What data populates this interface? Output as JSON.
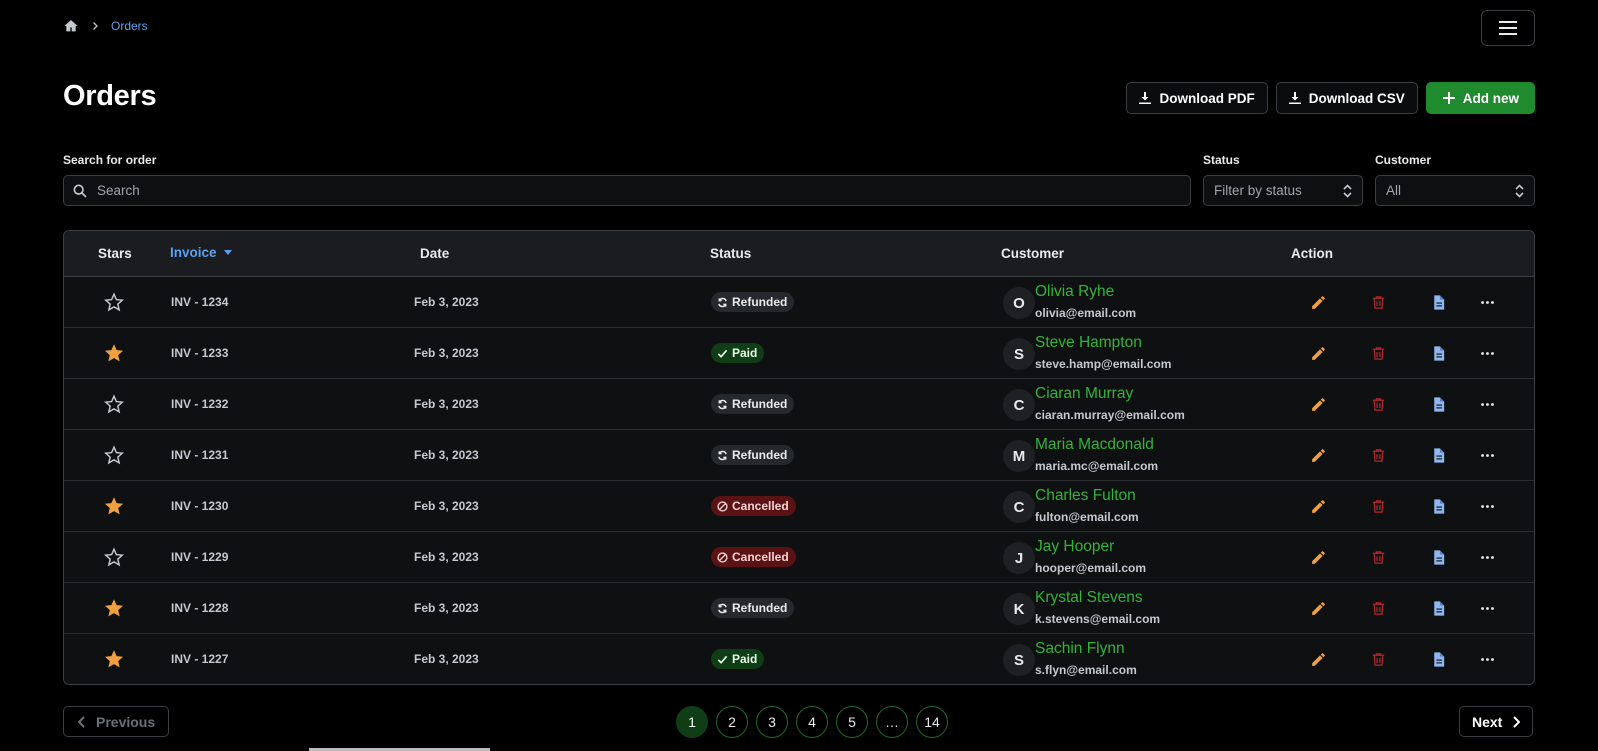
{
  "breadcrumb": {
    "home_icon": "home-icon",
    "current": "Orders"
  },
  "header": {
    "title": "Orders",
    "download_pdf": "Download PDF",
    "download_csv": "Download CSV",
    "add_new": "Add new"
  },
  "filters": {
    "search_label": "Search for order",
    "search_placeholder": "Search",
    "status_label": "Status",
    "status_value": "Filter by status",
    "customer_label": "Customer",
    "customer_value": "All"
  },
  "table": {
    "columns": {
      "stars": "Stars",
      "invoice": "Invoice",
      "date": "Date",
      "status": "Status",
      "customer": "Customer",
      "action": "Action"
    },
    "rows": [
      {
        "starred": false,
        "invoice": "INV - 1234",
        "date": "Feb 3, 2023",
        "status": "Refunded",
        "status_type": "refunded",
        "initial": "O",
        "name": "Olivia Ryhe",
        "email": "olivia@email.com"
      },
      {
        "starred": true,
        "invoice": "INV - 1233",
        "date": "Feb 3, 2023",
        "status": "Paid",
        "status_type": "paid",
        "initial": "S",
        "name": "Steve Hampton",
        "email": "steve.hamp@email.com"
      },
      {
        "starred": false,
        "invoice": "INV - 1232",
        "date": "Feb 3, 2023",
        "status": "Refunded",
        "status_type": "refunded",
        "initial": "C",
        "name": "Ciaran Murray",
        "email": "ciaran.murray@email.com"
      },
      {
        "starred": false,
        "invoice": "INV - 1231",
        "date": "Feb 3, 2023",
        "status": "Refunded",
        "status_type": "refunded",
        "initial": "M",
        "name": "Maria Macdonald",
        "email": "maria.mc@email.com"
      },
      {
        "starred": true,
        "invoice": "INV - 1230",
        "date": "Feb 3, 2023",
        "status": "Cancelled",
        "status_type": "cancelled",
        "initial": "C",
        "name": "Charles Fulton",
        "email": "fulton@email.com"
      },
      {
        "starred": false,
        "invoice": "INV - 1229",
        "date": "Feb 3, 2023",
        "status": "Cancelled",
        "status_type": "cancelled",
        "initial": "J",
        "name": "Jay Hooper",
        "email": "hooper@email.com"
      },
      {
        "starred": true,
        "invoice": "INV - 1228",
        "date": "Feb 3, 2023",
        "status": "Refunded",
        "status_type": "refunded",
        "initial": "K",
        "name": "Krystal Stevens",
        "email": "k.stevens@email.com"
      },
      {
        "starred": true,
        "invoice": "INV - 1227",
        "date": "Feb 3, 2023",
        "status": "Paid",
        "status_type": "paid",
        "initial": "S",
        "name": "Sachin Flynn",
        "email": "s.flyn@email.com"
      }
    ]
  },
  "pagination": {
    "previous": "Previous",
    "next": "Next",
    "pages": [
      "1",
      "2",
      "3",
      "4",
      "5",
      "…",
      "14"
    ],
    "current": "1"
  },
  "colors": {
    "accent_blue": "#5aa2f0",
    "brand_green": "#1f8a2e",
    "name_green": "#35b23c",
    "star_orange": "#f0a040",
    "edit_orange": "#f0a040",
    "delete_red": "#b3262b",
    "doc_blue": "#8fb8f0"
  }
}
